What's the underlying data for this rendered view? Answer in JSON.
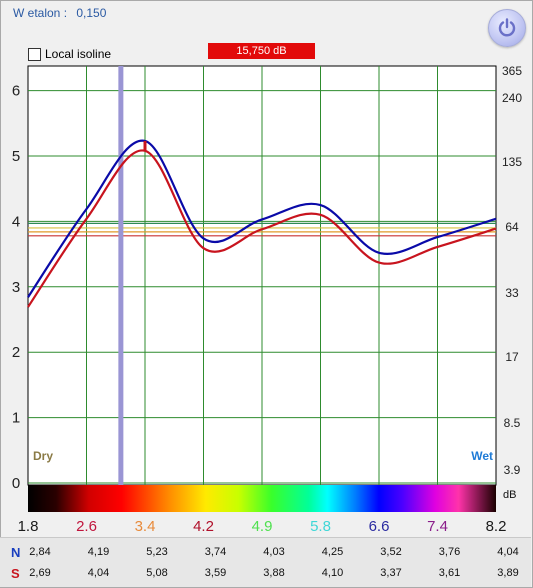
{
  "header": {
    "etalon_label": "W etalon :",
    "etalon_value": "0,150",
    "local_isoline_label": "Local isoline",
    "local_isoline_checked": false,
    "db_readout": "15,750 dB",
    "db_readout_color": "#e20a0a",
    "power_icon": "power-icon"
  },
  "chart_data": {
    "type": "line",
    "x": [
      1.8,
      2.6,
      3.4,
      4.2,
      4.9,
      5.8,
      6.6,
      7.4,
      8.2
    ],
    "xlim": [
      1.8,
      8.2
    ],
    "ylim": [
      0,
      6.5
    ],
    "left_ticks": [
      "0",
      "1",
      "2",
      "3",
      "4",
      "5",
      "6"
    ],
    "right_ticks": [
      "3.9",
      "8.5",
      "17",
      "33",
      "64",
      "135",
      "240",
      "365"
    ],
    "right_unit": "dB",
    "bottom_ticks": [
      {
        "label": "1.8",
        "color": "#1a1a1a"
      },
      {
        "label": "2.6",
        "color": "#c0143c"
      },
      {
        "label": "3.4",
        "color": "#e88a3a"
      },
      {
        "label": "4.2",
        "color": "#b0102a"
      },
      {
        "label": "4.9",
        "color": "#4fe04f"
      },
      {
        "label": "5.8",
        "color": "#3fd7d7"
      },
      {
        "label": "6.6",
        "color": "#2a2aa0"
      },
      {
        "label": "7.4",
        "color": "#8a1c8a"
      },
      {
        "label": "8.2",
        "color": "#1a1a1a"
      }
    ],
    "dry_label": "Dry",
    "wet_label": "Wet",
    "dry_color": "#8a7a45",
    "wet_color": "#1f7bd6",
    "series": [
      {
        "name": "N",
        "color": "#0a0aa8",
        "values": [
          2.84,
          4.19,
          5.23,
          3.74,
          4.03,
          4.25,
          3.52,
          3.76,
          4.04
        ]
      },
      {
        "name": "S",
        "color": "#c8141e",
        "values": [
          2.69,
          4.04,
          5.08,
          3.59,
          3.88,
          4.1,
          3.37,
          3.61,
          3.89
        ]
      }
    ],
    "reference_lines": [
      {
        "y": 3.97,
        "color": "#2e8b57"
      },
      {
        "y": 3.9,
        "color": "#d6c13c"
      },
      {
        "y": 3.84,
        "color": "#e09a2a"
      },
      {
        "y": 3.78,
        "color": "#c83232"
      }
    ],
    "cursor_x": 3.07,
    "cursor_color": "#9a95d4",
    "grid": true,
    "grid_color": "#2e8b2e"
  },
  "table": {
    "rows": [
      {
        "label": "N",
        "color": "#1a3fbf",
        "values": [
          "2,84",
          "4,19",
          "5,23",
          "3,74",
          "4,03",
          "4,25",
          "3,52",
          "3,76",
          "4,04"
        ]
      },
      {
        "label": "S",
        "color": "#c8141e",
        "values": [
          "2,69",
          "4,04",
          "5,08",
          "3,59",
          "3,88",
          "4,10",
          "3,37",
          "3,61",
          "3,89"
        ]
      }
    ]
  }
}
